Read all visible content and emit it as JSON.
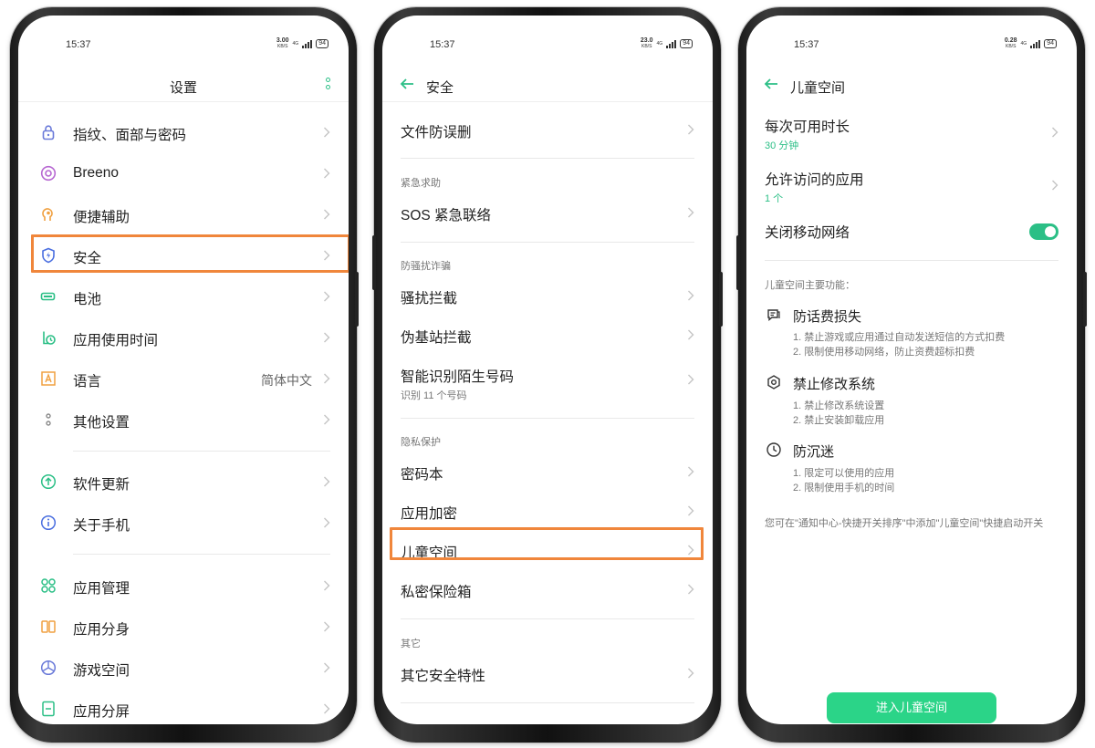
{
  "screens": [
    {
      "status": {
        "time": "15:37",
        "speed": "3.00",
        "speed_unit": "KB/S",
        "net": "4G",
        "battery": "94"
      },
      "title": "设置",
      "items": [
        {
          "label": "指纹、面部与密码",
          "icon": "lock-icon"
        },
        {
          "label": "Breeno",
          "icon": "breeno-icon"
        },
        {
          "label": "便捷辅助",
          "icon": "assist-icon"
        },
        {
          "label": "安全",
          "icon": "shield-icon"
        },
        {
          "label": "电池",
          "icon": "battery-icon"
        },
        {
          "label": "应用使用时间",
          "icon": "app-timer-icon"
        },
        {
          "label": "语言",
          "value": "简体中文",
          "icon": "language-icon"
        },
        {
          "label": "其他设置",
          "icon": "other-settings-icon"
        },
        {
          "label": "软件更新",
          "icon": "update-icon"
        },
        {
          "label": "关于手机",
          "icon": "info-icon"
        },
        {
          "label": "应用管理",
          "icon": "app-management-icon"
        },
        {
          "label": "应用分身",
          "icon": "app-clone-icon"
        },
        {
          "label": "游戏空间",
          "icon": "game-space-icon"
        },
        {
          "label": "应用分屏",
          "icon": "split-screen-icon"
        }
      ]
    },
    {
      "status": {
        "time": "15:37",
        "speed": "23.0",
        "speed_unit": "KB/S",
        "net": "4G",
        "battery": "94"
      },
      "title": "安全",
      "items": [
        {
          "label": "文件防误删"
        },
        {
          "section": "紧急求助"
        },
        {
          "label": "SOS 紧急联络"
        },
        {
          "section": "防骚扰诈骗"
        },
        {
          "label": "骚扰拦截"
        },
        {
          "label": "伪基站拦截"
        },
        {
          "label": "智能识别陌生号码",
          "sub": "识别 11 个号码"
        },
        {
          "section": "隐私保护"
        },
        {
          "label": "密码本"
        },
        {
          "label": "应用加密"
        },
        {
          "label": "儿童空间"
        },
        {
          "label": "私密保险箱"
        },
        {
          "section": "其它"
        },
        {
          "label": "其它安全特性"
        }
      ]
    },
    {
      "status": {
        "time": "15:37",
        "speed": "0.28",
        "speed_unit": "KB/S",
        "net": "4G",
        "battery": "94"
      },
      "title": "儿童空间",
      "settings": [
        {
          "label": "每次可用时长",
          "value": "30 分钟"
        },
        {
          "label": "允许访问的应用",
          "value": "1 个"
        },
        {
          "label": "关闭移动网络",
          "toggle": true
        }
      ],
      "features_title": "儿童空间主要功能：",
      "features": [
        {
          "title": "防话费损失",
          "icon": "message-icon",
          "lines": [
            "1. 禁止游戏或应用通过自动发送短信的方式扣费",
            "2. 限制使用移动网络，防止资费超标扣费"
          ]
        },
        {
          "title": "禁止修改系统",
          "icon": "settings-gear-icon",
          "lines": [
            "1. 禁止修改系统设置",
            "2. 禁止安装卸载应用"
          ]
        },
        {
          "title": "防沉迷",
          "icon": "clock-icon",
          "lines": [
            "1. 限定可以使用的应用",
            "2. 限制使用手机的时间"
          ]
        }
      ],
      "note": "您可在\"通知中心-快捷开关排序\"中添加\"儿童空间\"快捷启动开关",
      "enter_button": "进入儿童空间"
    }
  ],
  "colors": {
    "accent": "#2bbf86",
    "button": "#2bd488",
    "highlight": "#f0863b"
  }
}
